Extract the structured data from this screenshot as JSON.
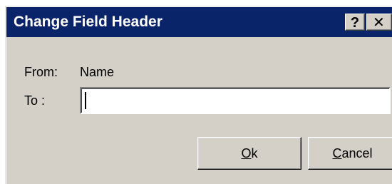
{
  "window": {
    "title": "Change Field Header",
    "help_glyph": "?",
    "close_glyph": "✕"
  },
  "form": {
    "from_label": "From:",
    "from_value": "Name",
    "to_label": "To :",
    "to_value": ""
  },
  "buttons": {
    "ok": {
      "mnemonic": "O",
      "rest": "k"
    },
    "cancel": {
      "mnemonic": "C",
      "rest": "ancel"
    }
  },
  "colors": {
    "titlebar": "#0a246a",
    "face": "#d4d0c8"
  }
}
